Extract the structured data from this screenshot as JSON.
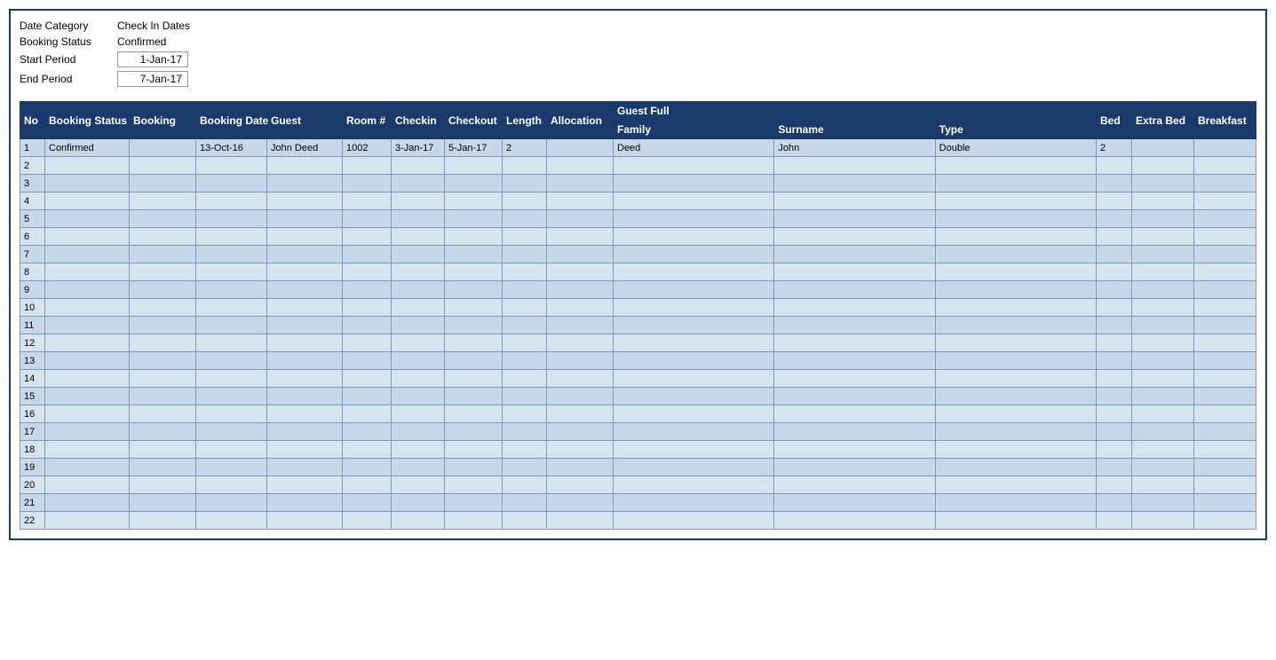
{
  "filters": {
    "date_category_label": "Date Category",
    "date_category_value": "Check In Dates",
    "booking_status_label": "Booking Status",
    "booking_status_value": "Confirmed",
    "start_period_label": "Start Period",
    "start_period_value": "1-Jan-17",
    "end_period_label": "End Period",
    "end_period_value": "7-Jan-17"
  },
  "table": {
    "headers_top": [
      {
        "label": "No",
        "colspan": 1,
        "rowspan": 2
      },
      {
        "label": "Booking Status",
        "colspan": 1,
        "rowspan": 2
      },
      {
        "label": "Booking",
        "colspan": 1,
        "rowspan": 2
      },
      {
        "label": "Booking Date",
        "colspan": 1,
        "rowspan": 2
      },
      {
        "label": "Guest",
        "colspan": 1,
        "rowspan": 2
      },
      {
        "label": "Room #",
        "colspan": 1,
        "rowspan": 2
      },
      {
        "label": "Checkin",
        "colspan": 1,
        "rowspan": 2
      },
      {
        "label": "Checkout",
        "colspan": 1,
        "rowspan": 2
      },
      {
        "label": "Length",
        "colspan": 1,
        "rowspan": 2
      },
      {
        "label": "Allocation",
        "colspan": 1,
        "rowspan": 2
      },
      {
        "label": "Guest Full",
        "colspan": 3,
        "rowspan": 1
      },
      {
        "label": "Bed",
        "colspan": 1,
        "rowspan": 2
      },
      {
        "label": "Extra Bed",
        "colspan": 1,
        "rowspan": 2
      },
      {
        "label": "Breakfast",
        "colspan": 1,
        "rowspan": 2
      }
    ],
    "headers_sub": [
      "Family",
      "Surname",
      "Type"
    ],
    "rows": [
      {
        "no": "1",
        "booking_status": "Confirmed",
        "booking": "",
        "booking_date": "13-Oct-16",
        "guest": "John Deed",
        "room": "1002",
        "checkin": "3-Jan-17",
        "checkout": "5-Jan-17",
        "length": "2",
        "allocation": "",
        "family": "Deed",
        "surname": "John",
        "type": "Double",
        "bed": "2",
        "extrabed": "",
        "breakfast": ""
      },
      {
        "no": "2",
        "booking_status": "",
        "booking": "",
        "booking_date": "",
        "guest": "",
        "room": "",
        "checkin": "",
        "checkout": "",
        "length": "",
        "allocation": "",
        "family": "",
        "surname": "",
        "type": "",
        "bed": "",
        "extrabed": "",
        "breakfast": ""
      },
      {
        "no": "3",
        "booking_status": "",
        "booking": "",
        "booking_date": "",
        "guest": "",
        "room": "",
        "checkin": "",
        "checkout": "",
        "length": "",
        "allocation": "",
        "family": "",
        "surname": "",
        "type": "",
        "bed": "",
        "extrabed": "",
        "breakfast": ""
      },
      {
        "no": "4",
        "booking_status": "",
        "booking": "",
        "booking_date": "",
        "guest": "",
        "room": "",
        "checkin": "",
        "checkout": "",
        "length": "",
        "allocation": "",
        "family": "",
        "surname": "",
        "type": "",
        "bed": "",
        "extrabed": "",
        "breakfast": ""
      },
      {
        "no": "5",
        "booking_status": "",
        "booking": "",
        "booking_date": "",
        "guest": "",
        "room": "",
        "checkin": "",
        "checkout": "",
        "length": "",
        "allocation": "",
        "family": "",
        "surname": "",
        "type": "",
        "bed": "",
        "extrabed": "",
        "breakfast": ""
      },
      {
        "no": "6",
        "booking_status": "",
        "booking": "",
        "booking_date": "",
        "guest": "",
        "room": "",
        "checkin": "",
        "checkout": "",
        "length": "",
        "allocation": "",
        "family": "",
        "surname": "",
        "type": "",
        "bed": "",
        "extrabed": "",
        "breakfast": ""
      },
      {
        "no": "7",
        "booking_status": "",
        "booking": "",
        "booking_date": "",
        "guest": "",
        "room": "",
        "checkin": "",
        "checkout": "",
        "length": "",
        "allocation": "",
        "family": "",
        "surname": "",
        "type": "",
        "bed": "",
        "extrabed": "",
        "breakfast": ""
      },
      {
        "no": "8",
        "booking_status": "",
        "booking": "",
        "booking_date": "",
        "guest": "",
        "room": "",
        "checkin": "",
        "checkout": "",
        "length": "",
        "allocation": "",
        "family": "",
        "surname": "",
        "type": "",
        "bed": "",
        "extrabed": "",
        "breakfast": ""
      },
      {
        "no": "9",
        "booking_status": "",
        "booking": "",
        "booking_date": "",
        "guest": "",
        "room": "",
        "checkin": "",
        "checkout": "",
        "length": "",
        "allocation": "",
        "family": "",
        "surname": "",
        "type": "",
        "bed": "",
        "extrabed": "",
        "breakfast": ""
      },
      {
        "no": "10",
        "booking_status": "",
        "booking": "",
        "booking_date": "",
        "guest": "",
        "room": "",
        "checkin": "",
        "checkout": "",
        "length": "",
        "allocation": "",
        "family": "",
        "surname": "",
        "type": "",
        "bed": "",
        "extrabed": "",
        "breakfast": ""
      },
      {
        "no": "11",
        "booking_status": "",
        "booking": "",
        "booking_date": "",
        "guest": "",
        "room": "",
        "checkin": "",
        "checkout": "",
        "length": "",
        "allocation": "",
        "family": "",
        "surname": "",
        "type": "",
        "bed": "",
        "extrabed": "",
        "breakfast": ""
      },
      {
        "no": "12",
        "booking_status": "",
        "booking": "",
        "booking_date": "",
        "guest": "",
        "room": "",
        "checkin": "",
        "checkout": "",
        "length": "",
        "allocation": "",
        "family": "",
        "surname": "",
        "type": "",
        "bed": "",
        "extrabed": "",
        "breakfast": ""
      },
      {
        "no": "13",
        "booking_status": "",
        "booking": "",
        "booking_date": "",
        "guest": "",
        "room": "",
        "checkin": "",
        "checkout": "",
        "length": "",
        "allocation": "",
        "family": "",
        "surname": "",
        "type": "",
        "bed": "",
        "extrabed": "",
        "breakfast": ""
      },
      {
        "no": "14",
        "booking_status": "",
        "booking": "",
        "booking_date": "",
        "guest": "",
        "room": "",
        "checkin": "",
        "checkout": "",
        "length": "",
        "allocation": "",
        "family": "",
        "surname": "",
        "type": "",
        "bed": "",
        "extrabed": "",
        "breakfast": ""
      },
      {
        "no": "15",
        "booking_status": "",
        "booking": "",
        "booking_date": "",
        "guest": "",
        "room": "",
        "checkin": "",
        "checkout": "",
        "length": "",
        "allocation": "",
        "family": "",
        "surname": "",
        "type": "",
        "bed": "",
        "extrabed": "",
        "breakfast": ""
      },
      {
        "no": "16",
        "booking_status": "",
        "booking": "",
        "booking_date": "",
        "guest": "",
        "room": "",
        "checkin": "",
        "checkout": "",
        "length": "",
        "allocation": "",
        "family": "",
        "surname": "",
        "type": "",
        "bed": "",
        "extrabed": "",
        "breakfast": ""
      },
      {
        "no": "17",
        "booking_status": "",
        "booking": "",
        "booking_date": "",
        "guest": "",
        "room": "",
        "checkin": "",
        "checkout": "",
        "length": "",
        "allocation": "",
        "family": "",
        "surname": "",
        "type": "",
        "bed": "",
        "extrabed": "",
        "breakfast": ""
      },
      {
        "no": "18",
        "booking_status": "",
        "booking": "",
        "booking_date": "",
        "guest": "",
        "room": "",
        "checkin": "",
        "checkout": "",
        "length": "",
        "allocation": "",
        "family": "",
        "surname": "",
        "type": "",
        "bed": "",
        "extrabed": "",
        "breakfast": ""
      },
      {
        "no": "19",
        "booking_status": "",
        "booking": "",
        "booking_date": "",
        "guest": "",
        "room": "",
        "checkin": "",
        "checkout": "",
        "length": "",
        "allocation": "",
        "family": "",
        "surname": "",
        "type": "",
        "bed": "",
        "extrabed": "",
        "breakfast": ""
      },
      {
        "no": "20",
        "booking_status": "",
        "booking": "",
        "booking_date": "",
        "guest": "",
        "room": "",
        "checkin": "",
        "checkout": "",
        "length": "",
        "allocation": "",
        "family": "",
        "surname": "",
        "type": "",
        "bed": "",
        "extrabed": "",
        "breakfast": ""
      },
      {
        "no": "21",
        "booking_status": "",
        "booking": "",
        "booking_date": "",
        "guest": "",
        "room": "",
        "checkin": "",
        "checkout": "",
        "length": "",
        "allocation": "",
        "family": "",
        "surname": "",
        "type": "",
        "bed": "",
        "extrabed": "",
        "breakfast": ""
      },
      {
        "no": "22",
        "booking_status": "",
        "booking": "",
        "booking_date": "",
        "guest": "",
        "room": "",
        "checkin": "",
        "checkout": "",
        "length": "",
        "allocation": "",
        "family": "",
        "surname": "",
        "type": "",
        "bed": "",
        "extrabed": "",
        "breakfast": ""
      }
    ]
  }
}
